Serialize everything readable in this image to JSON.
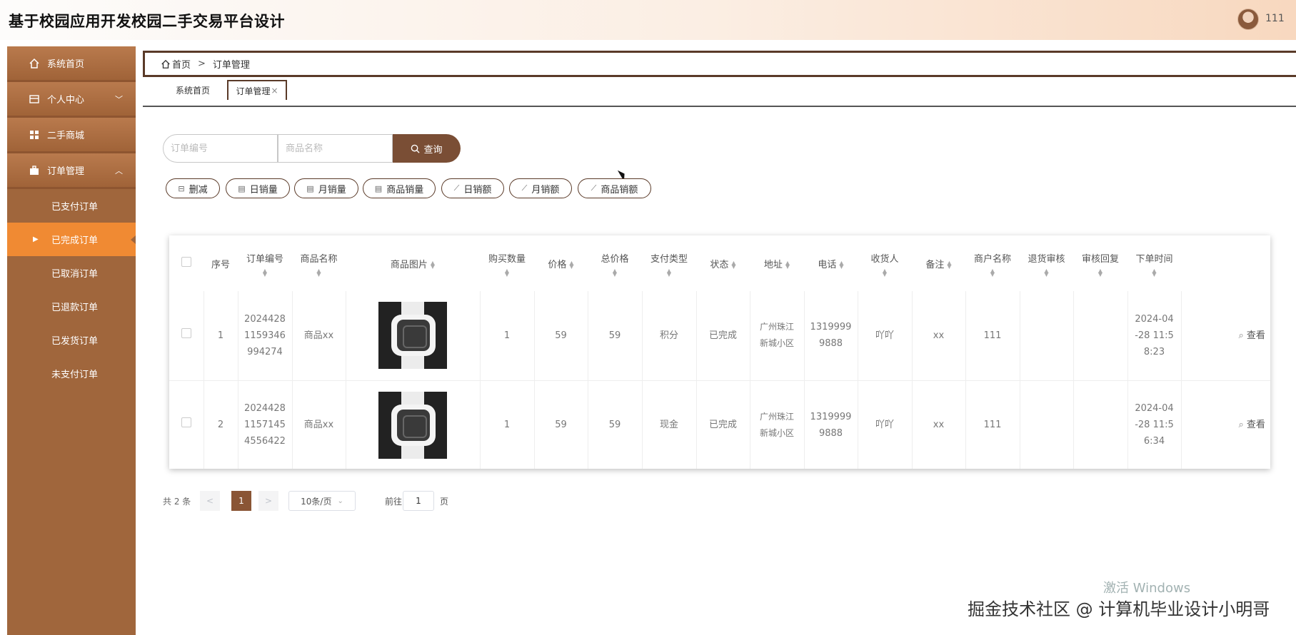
{
  "app": {
    "title": "基于校园应用开发校园二手交易平台设计",
    "user": "111"
  },
  "sidebar": {
    "items": [
      {
        "label": "系统首页",
        "icon": "home-icon"
      },
      {
        "label": "个人中心",
        "icon": "profile-icon",
        "chevron": "﹀"
      },
      {
        "label": "二手商城",
        "icon": "grid-icon"
      },
      {
        "label": "订单管理",
        "icon": "briefcase-icon",
        "chevron": "︿"
      }
    ],
    "sub_items": [
      {
        "label": "已支付订单"
      },
      {
        "label": "已完成订单",
        "active": true
      },
      {
        "label": "已取消订单"
      },
      {
        "label": "已退款订单"
      },
      {
        "label": "已发货订单"
      },
      {
        "label": "未支付订单"
      }
    ]
  },
  "breadcrumb": {
    "home": "首页",
    "sep": ">",
    "current": "订单管理"
  },
  "tabs": [
    {
      "label": "系统首页"
    },
    {
      "label": "订单管理",
      "close": "×",
      "active": true
    }
  ],
  "search": {
    "order_placeholder": "订单编号",
    "goods_placeholder": "商品名称",
    "button_label": "查询"
  },
  "actions": [
    "删减",
    "日销量",
    "月销量",
    "商品销量",
    "日销额",
    "月销额",
    "商品销额"
  ],
  "table": {
    "columns": [
      "序号",
      "订单编号",
      "商品名称",
      "商品图片",
      "购买数量",
      "价格",
      "总价格",
      "支付类型",
      "状态",
      "地址",
      "电话",
      "收货人",
      "备注",
      "商户名称",
      "退货审核",
      "审核回复",
      "下单时间"
    ],
    "rows": [
      {
        "index": "1",
        "order_no": [
          "2024428",
          "1159346",
          "994274"
        ],
        "goods": "商品xx",
        "qty": "1",
        "price": "59",
        "total": "59",
        "pay_type": "积分",
        "status": "已完成",
        "address": [
          "广州珠江",
          "新城小区"
        ],
        "phone": [
          "1319999",
          "9888"
        ],
        "receiver": "吖吖",
        "remark": "xx",
        "merchant": "111",
        "refund_review": "",
        "review_reply": "",
        "time": [
          "2024-04",
          "-28 11:5",
          "8:23"
        ],
        "action": "查看"
      },
      {
        "index": "2",
        "order_no": [
          "2024428",
          "1157145",
          "4556422"
        ],
        "goods": "商品xx",
        "qty": "1",
        "price": "59",
        "total": "59",
        "pay_type": "现金",
        "status": "已完成",
        "address": [
          "广州珠江",
          "新城小区"
        ],
        "phone": [
          "1319999",
          "9888"
        ],
        "receiver": "吖吖",
        "remark": "xx",
        "merchant": "111",
        "refund_review": "",
        "review_reply": "",
        "time": [
          "2024-04",
          "-28 11:5",
          "6:34"
        ],
        "action": "查看"
      }
    ]
  },
  "pagination": {
    "total": "共 2 条",
    "prev": "<",
    "page": "1",
    "next": ">",
    "page_size": "10条/页",
    "goto_label": "前往",
    "goto_value": "1",
    "goto_suffix": "页"
  },
  "overlay": {
    "activate_windows": "激活 Windows",
    "footer": "掘金技术社区 @ 计算机毕业设计小明哥"
  },
  "colors": {
    "sidebar": "#a0663c",
    "active": "#f08a33",
    "accent": "#7a4e35"
  }
}
